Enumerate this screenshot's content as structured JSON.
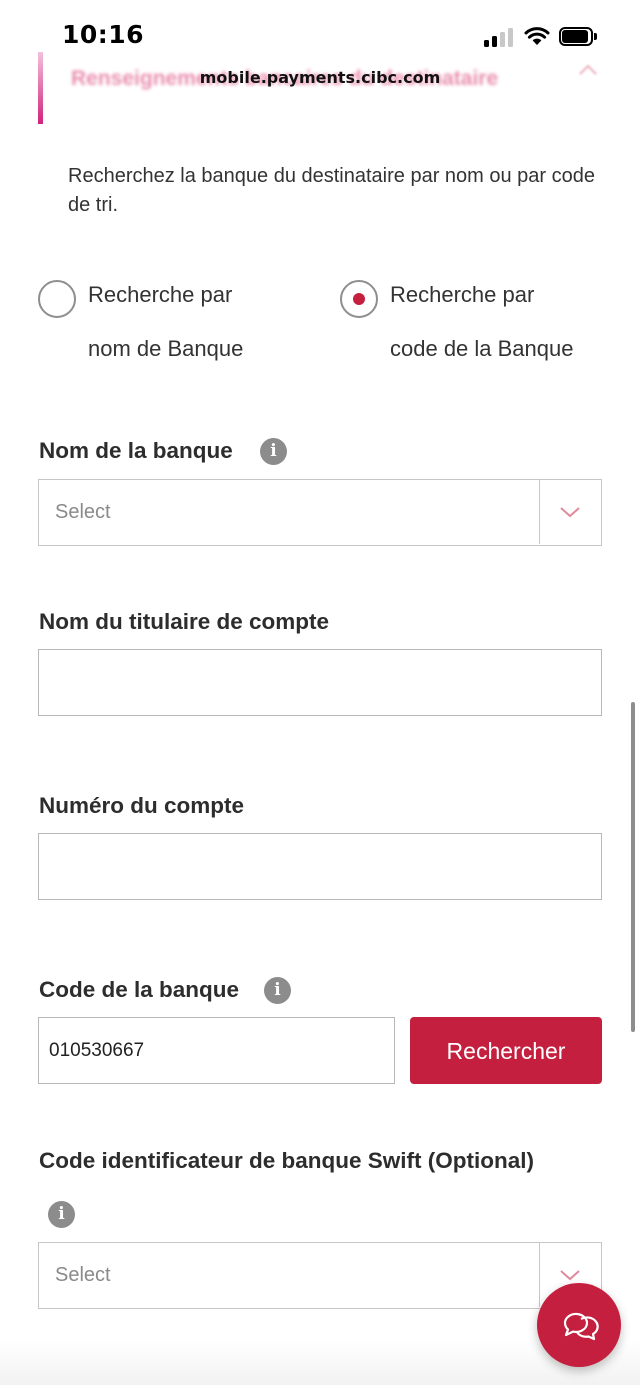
{
  "status_bar": {
    "time": "10:16"
  },
  "browser": {
    "url": "mobile.payments.cibc.com"
  },
  "section": {
    "title": "Renseignements bancaires du destinataire"
  },
  "intro_text": "Recherchez la banque du destinataire par nom ou par code de tri.",
  "search_mode": {
    "options": [
      {
        "line1": "Recherche par",
        "line2": "nom de Banque",
        "selected": false
      },
      {
        "line1": "Recherche par",
        "line2": "code de la Banque",
        "selected": true
      }
    ]
  },
  "bank_name": {
    "label": "Nom de la banque",
    "placeholder": "Select"
  },
  "account_holder": {
    "label": "Nom du titulaire de compte",
    "value": ""
  },
  "account_number": {
    "label": "Numéro du compte",
    "value": ""
  },
  "bank_code": {
    "label": "Code de la banque",
    "value": "010530667",
    "search_label": "Rechercher"
  },
  "swift": {
    "label": "Code identificateur de banque Swift (Optional)",
    "placeholder": "Select"
  },
  "colors": {
    "brand": "#c41f3e",
    "section_accent": "#d0237c"
  },
  "icons": {
    "info": "info-icon",
    "chat": "chat-icon",
    "chevron": "chevron-down-icon"
  }
}
